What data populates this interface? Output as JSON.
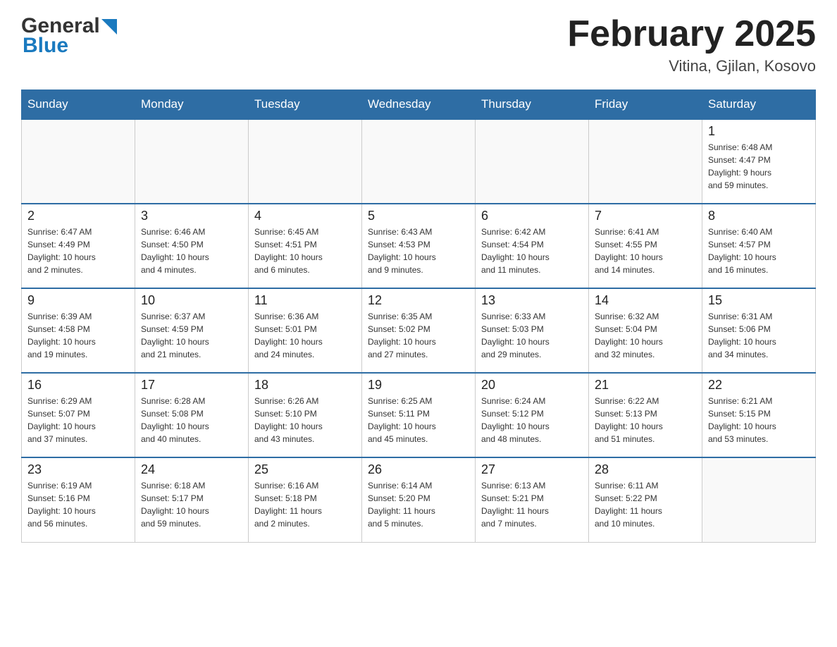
{
  "header": {
    "logo_general": "General",
    "logo_blue": "Blue",
    "month_title": "February 2025",
    "location": "Vitina, Gjilan, Kosovo"
  },
  "days_of_week": [
    "Sunday",
    "Monday",
    "Tuesday",
    "Wednesday",
    "Thursday",
    "Friday",
    "Saturday"
  ],
  "weeks": [
    [
      {
        "day": "",
        "info": ""
      },
      {
        "day": "",
        "info": ""
      },
      {
        "day": "",
        "info": ""
      },
      {
        "day": "",
        "info": ""
      },
      {
        "day": "",
        "info": ""
      },
      {
        "day": "",
        "info": ""
      },
      {
        "day": "1",
        "info": "Sunrise: 6:48 AM\nSunset: 4:47 PM\nDaylight: 9 hours\nand 59 minutes."
      }
    ],
    [
      {
        "day": "2",
        "info": "Sunrise: 6:47 AM\nSunset: 4:49 PM\nDaylight: 10 hours\nand 2 minutes."
      },
      {
        "day": "3",
        "info": "Sunrise: 6:46 AM\nSunset: 4:50 PM\nDaylight: 10 hours\nand 4 minutes."
      },
      {
        "day": "4",
        "info": "Sunrise: 6:45 AM\nSunset: 4:51 PM\nDaylight: 10 hours\nand 6 minutes."
      },
      {
        "day": "5",
        "info": "Sunrise: 6:43 AM\nSunset: 4:53 PM\nDaylight: 10 hours\nand 9 minutes."
      },
      {
        "day": "6",
        "info": "Sunrise: 6:42 AM\nSunset: 4:54 PM\nDaylight: 10 hours\nand 11 minutes."
      },
      {
        "day": "7",
        "info": "Sunrise: 6:41 AM\nSunset: 4:55 PM\nDaylight: 10 hours\nand 14 minutes."
      },
      {
        "day": "8",
        "info": "Sunrise: 6:40 AM\nSunset: 4:57 PM\nDaylight: 10 hours\nand 16 minutes."
      }
    ],
    [
      {
        "day": "9",
        "info": "Sunrise: 6:39 AM\nSunset: 4:58 PM\nDaylight: 10 hours\nand 19 minutes."
      },
      {
        "day": "10",
        "info": "Sunrise: 6:37 AM\nSunset: 4:59 PM\nDaylight: 10 hours\nand 21 minutes."
      },
      {
        "day": "11",
        "info": "Sunrise: 6:36 AM\nSunset: 5:01 PM\nDaylight: 10 hours\nand 24 minutes."
      },
      {
        "day": "12",
        "info": "Sunrise: 6:35 AM\nSunset: 5:02 PM\nDaylight: 10 hours\nand 27 minutes."
      },
      {
        "day": "13",
        "info": "Sunrise: 6:33 AM\nSunset: 5:03 PM\nDaylight: 10 hours\nand 29 minutes."
      },
      {
        "day": "14",
        "info": "Sunrise: 6:32 AM\nSunset: 5:04 PM\nDaylight: 10 hours\nand 32 minutes."
      },
      {
        "day": "15",
        "info": "Sunrise: 6:31 AM\nSunset: 5:06 PM\nDaylight: 10 hours\nand 34 minutes."
      }
    ],
    [
      {
        "day": "16",
        "info": "Sunrise: 6:29 AM\nSunset: 5:07 PM\nDaylight: 10 hours\nand 37 minutes."
      },
      {
        "day": "17",
        "info": "Sunrise: 6:28 AM\nSunset: 5:08 PM\nDaylight: 10 hours\nand 40 minutes."
      },
      {
        "day": "18",
        "info": "Sunrise: 6:26 AM\nSunset: 5:10 PM\nDaylight: 10 hours\nand 43 minutes."
      },
      {
        "day": "19",
        "info": "Sunrise: 6:25 AM\nSunset: 5:11 PM\nDaylight: 10 hours\nand 45 minutes."
      },
      {
        "day": "20",
        "info": "Sunrise: 6:24 AM\nSunset: 5:12 PM\nDaylight: 10 hours\nand 48 minutes."
      },
      {
        "day": "21",
        "info": "Sunrise: 6:22 AM\nSunset: 5:13 PM\nDaylight: 10 hours\nand 51 minutes."
      },
      {
        "day": "22",
        "info": "Sunrise: 6:21 AM\nSunset: 5:15 PM\nDaylight: 10 hours\nand 53 minutes."
      }
    ],
    [
      {
        "day": "23",
        "info": "Sunrise: 6:19 AM\nSunset: 5:16 PM\nDaylight: 10 hours\nand 56 minutes."
      },
      {
        "day": "24",
        "info": "Sunrise: 6:18 AM\nSunset: 5:17 PM\nDaylight: 10 hours\nand 59 minutes."
      },
      {
        "day": "25",
        "info": "Sunrise: 6:16 AM\nSunset: 5:18 PM\nDaylight: 11 hours\nand 2 minutes."
      },
      {
        "day": "26",
        "info": "Sunrise: 6:14 AM\nSunset: 5:20 PM\nDaylight: 11 hours\nand 5 minutes."
      },
      {
        "day": "27",
        "info": "Sunrise: 6:13 AM\nSunset: 5:21 PM\nDaylight: 11 hours\nand 7 minutes."
      },
      {
        "day": "28",
        "info": "Sunrise: 6:11 AM\nSunset: 5:22 PM\nDaylight: 11 hours\nand 10 minutes."
      },
      {
        "day": "",
        "info": ""
      }
    ]
  ]
}
